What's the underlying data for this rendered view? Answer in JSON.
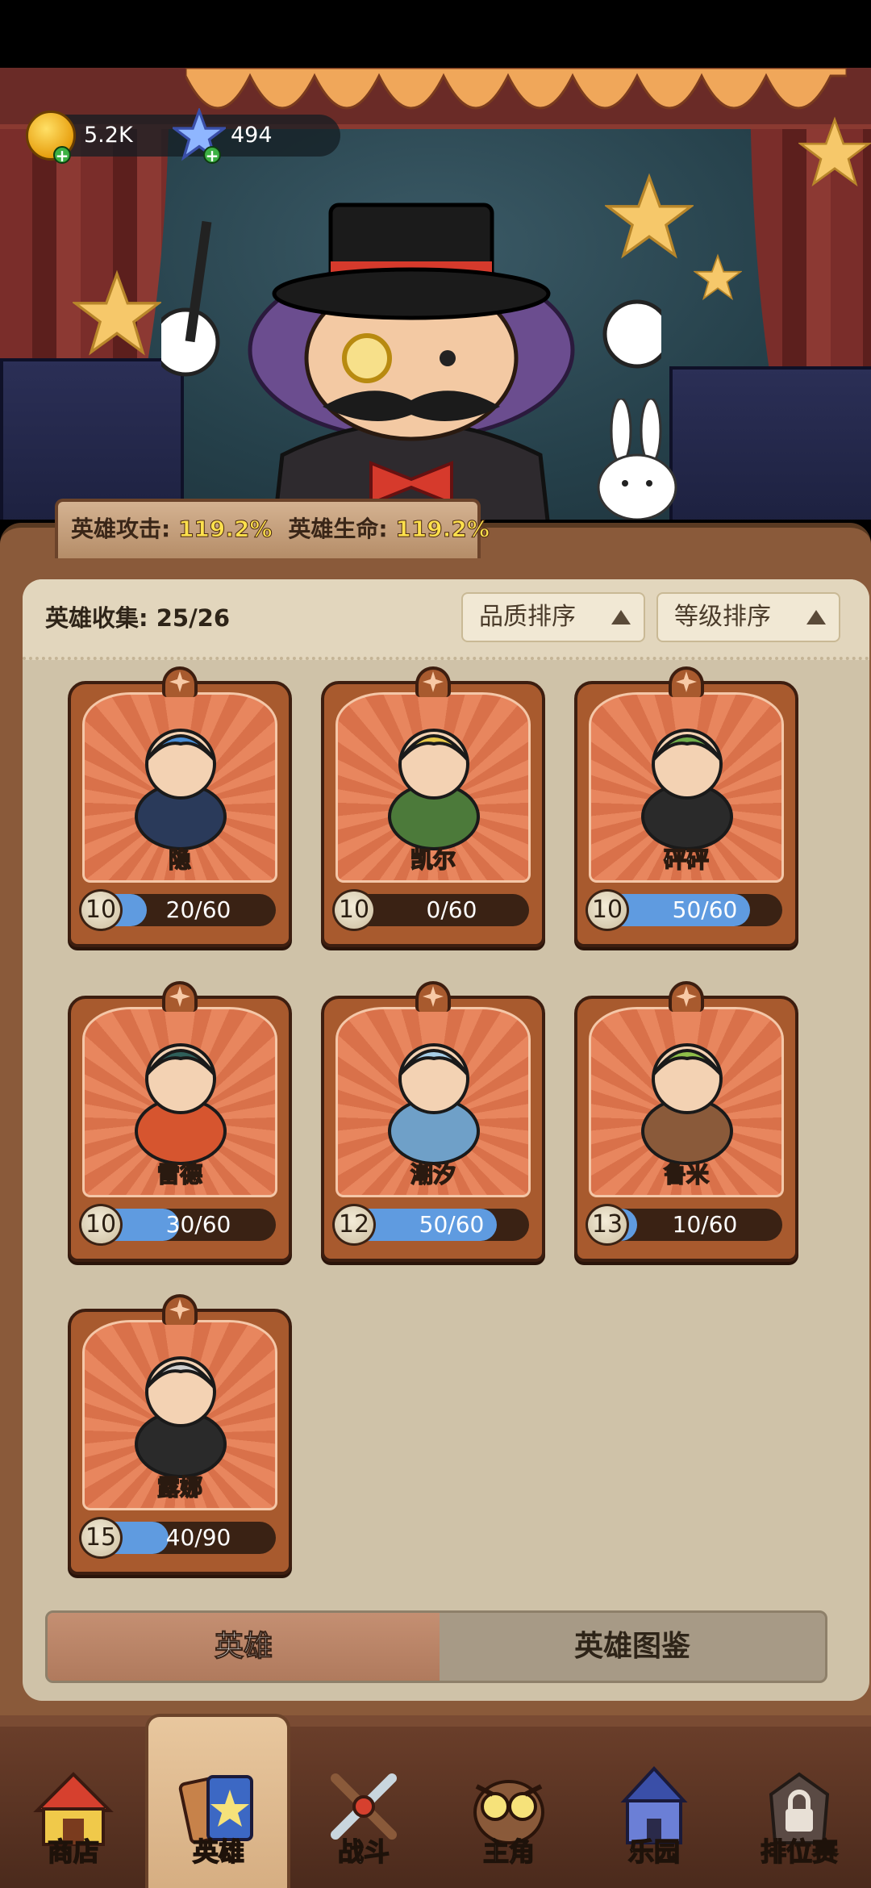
{
  "currency": {
    "gold": "5.2K",
    "gems": "494"
  },
  "bonus": {
    "attack_label": "英雄攻击:",
    "attack_value": "119.2%",
    "hp_label": "英雄生命:",
    "hp_value": "119.2%"
  },
  "collection": {
    "label": "英雄收集:",
    "count": "25/26"
  },
  "sort": {
    "quality": "品质排序",
    "level": "等级排序"
  },
  "heroes": [
    {
      "name": "隐",
      "level": "10",
      "progress": "20/60",
      "fraction": 0.3333
    },
    {
      "name": "凯尔",
      "level": "10",
      "progress": "0/60",
      "fraction": 0.0
    },
    {
      "name": "砰砰",
      "level": "10",
      "progress": "50/60",
      "fraction": 0.8333
    },
    {
      "name": "雷德",
      "level": "10",
      "progress": "30/60",
      "fraction": 0.5
    },
    {
      "name": "潮汐",
      "level": "12",
      "progress": "50/60",
      "fraction": 0.8333
    },
    {
      "name": "鲁米",
      "level": "13",
      "progress": "10/60",
      "fraction": 0.1667
    },
    {
      "name": "露娜",
      "level": "15",
      "progress": "40/90",
      "fraction": 0.4444
    }
  ],
  "tabs": {
    "heroes": "英雄",
    "codex": "英雄图鉴"
  },
  "nav": [
    {
      "label": "商店",
      "icon": "shop-tent-icon"
    },
    {
      "label": "英雄",
      "icon": "hero-cards-icon"
    },
    {
      "label": "战斗",
      "icon": "battle-swords-icon"
    },
    {
      "label": "主角",
      "icon": "owl-protagonist-icon"
    },
    {
      "label": "乐园",
      "icon": "castle-park-icon"
    },
    {
      "label": "排位赛",
      "icon": "lock-icon"
    }
  ],
  "colors": {
    "bar_fill": "#5f9be0",
    "card_frame": "#a85a2e",
    "panel": "#cfc2a8"
  }
}
